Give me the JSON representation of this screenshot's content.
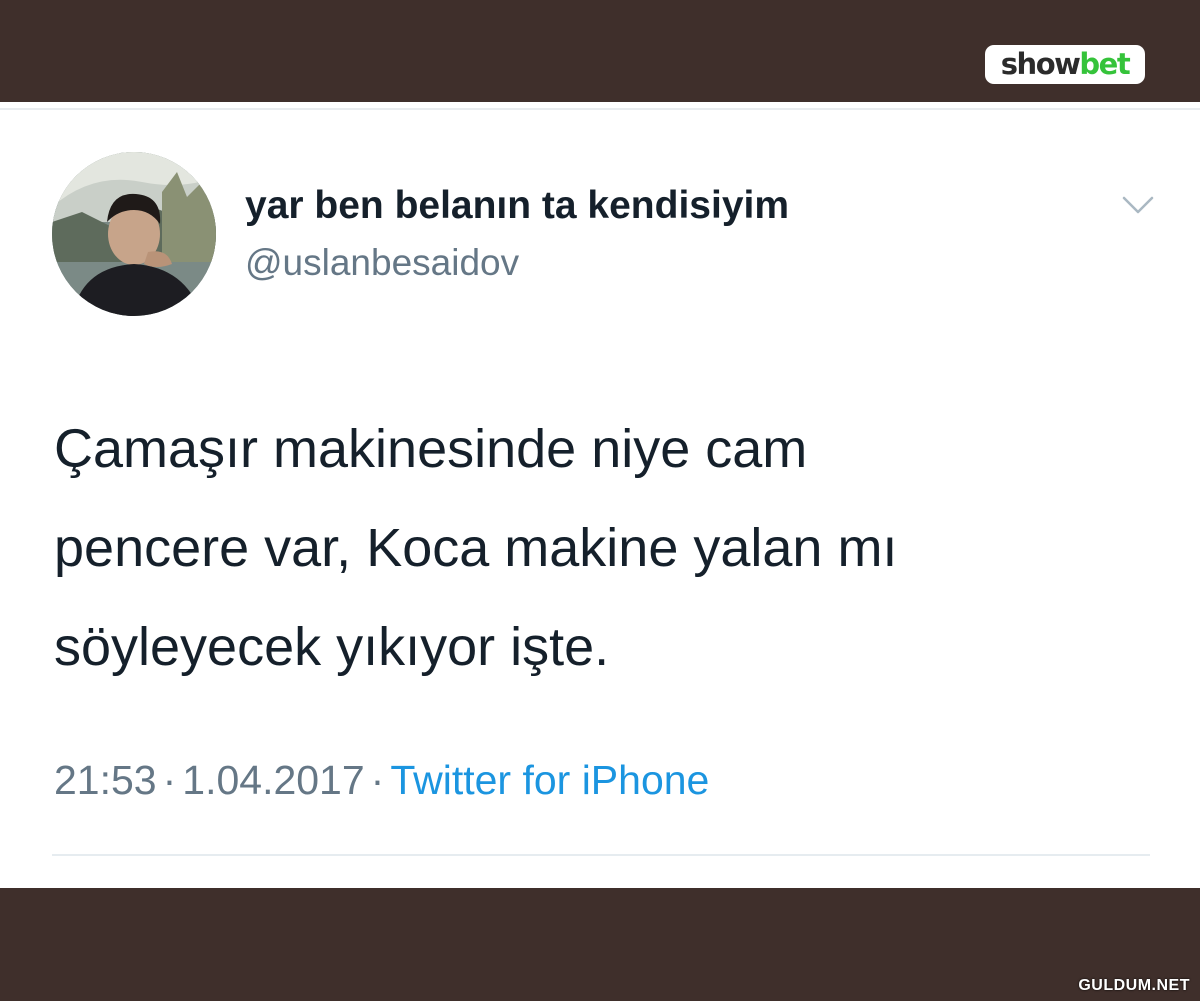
{
  "brand": {
    "logo_part1": "show",
    "logo_part2": "bet",
    "logo_color": "#35c33a"
  },
  "tweet": {
    "author_name": "yar ben belanın ta kendisiyim",
    "author_handle": "@uslanbesaidov",
    "menu_icon": "chevron-down-icon",
    "avatar_icon": "avatar-photo",
    "text_lines": [
      "Çamaşır makinesinde niye cam",
      "pencere var, Koca makine yalan mı",
      "söyleyecek yıkıyor işte."
    ],
    "time": "21:53",
    "date": "1.04.2017",
    "separator": "·",
    "source": "Twitter for iPhone",
    "accent_color": "#1b95e0"
  },
  "watermark": "GULDUM.NET"
}
